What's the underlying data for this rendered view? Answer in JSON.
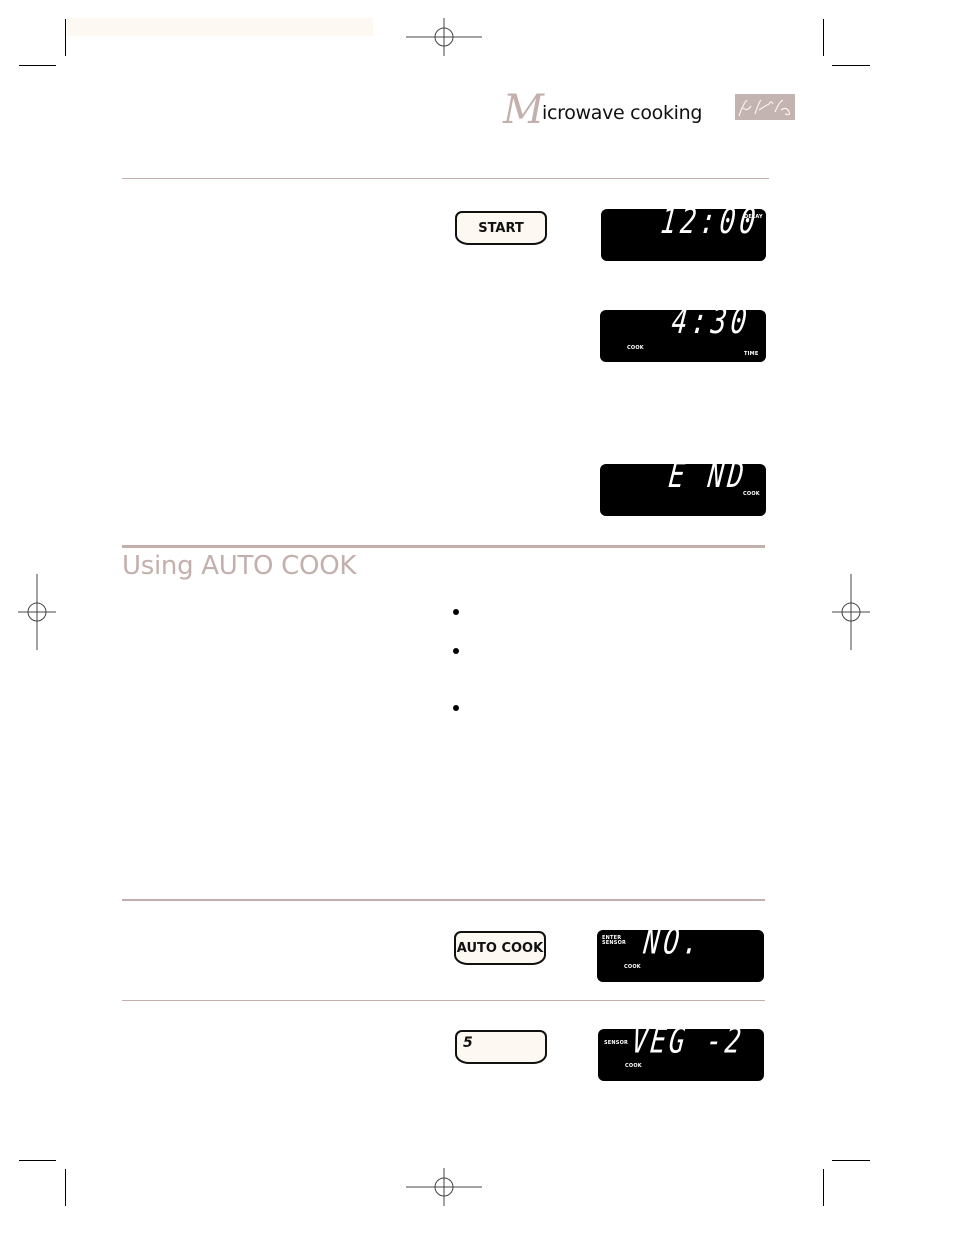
{
  "header": {
    "title_initial": "M",
    "title_rest": "icrowave cooking",
    "signature_logo": "signature-logo"
  },
  "section": {
    "title": "Using AUTO COOK"
  },
  "keys": {
    "start": "START",
    "auto_cook": "AUTO COOK",
    "number_five": "5"
  },
  "displays": {
    "delay": {
      "digits": "12:00",
      "tags": [
        "DELAY"
      ]
    },
    "cook_time": {
      "digits": "4:30",
      "tags": [
        "COOK",
        "TIME"
      ]
    },
    "end": {
      "digits": "E ND",
      "tags": [
        "COOK"
      ]
    },
    "sensor_no": {
      "digits": "NO.",
      "tags": [
        "ENTER",
        "SENSOR",
        "COOK"
      ]
    },
    "sensor_veg": {
      "digits": "VEG -2",
      "tags": [
        "SENSOR",
        "COOK"
      ]
    }
  },
  "bullets": {
    "count": 3
  },
  "colors": {
    "accent": "#c3b0ad",
    "key_fill": "#fdf8f2",
    "display_bg": "#000000",
    "text": "#111111"
  }
}
